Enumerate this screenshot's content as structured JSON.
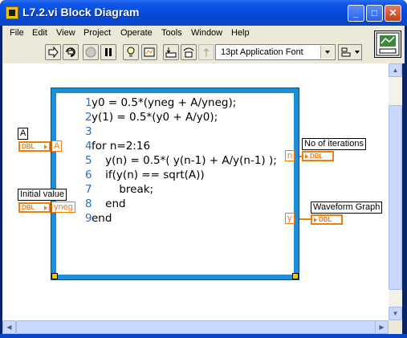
{
  "window": {
    "title": "L7.2.vi Block Diagram"
  },
  "menu": [
    "File",
    "Edit",
    "View",
    "Project",
    "Operate",
    "Tools",
    "Window",
    "Help"
  ],
  "toolbar": {
    "font": "13pt Application Font",
    "tools": [
      "run-arrow-icon",
      "run-continuous-icon",
      "abort-icon",
      "pause-icon",
      "highlight-execution-icon",
      "retain-wire-values-icon",
      "step-into-icon",
      "step-over-icon",
      "step-out-icon"
    ]
  },
  "formula": {
    "lines": [
      {
        "n": "1",
        "text": "y0 = 0.5*(yneg + A/yneg);"
      },
      {
        "n": "2",
        "text": "y(1) = 0.5*(y0 + A/y0);"
      },
      {
        "n": "3",
        "text": ""
      },
      {
        "n": "4",
        "text": "for n=2:16"
      },
      {
        "n": "5",
        "text": "    y(n) = 0.5*( y(n-1) + A/y(n-1) );"
      },
      {
        "n": "6",
        "text": "    if(y(n) == sqrt(A))"
      },
      {
        "n": "7",
        "text": "        break;"
      },
      {
        "n": "8",
        "text": "    end"
      },
      {
        "n": "9",
        "text": "end"
      }
    ]
  },
  "inputs": {
    "a": {
      "label": "A",
      "terminal": "A",
      "type": "DBL"
    },
    "initial": {
      "label": "Initial value",
      "terminal": "yneg",
      "type": "DBL"
    }
  },
  "outputs": {
    "iterations": {
      "label": "No of iterations",
      "terminal": "n",
      "type": "DBL"
    },
    "graph": {
      "label": "Waveform Graph",
      "terminal": "y",
      "type": "DBL"
    }
  },
  "colors": {
    "wire": "#f07d0f",
    "node_border": "#1e8fd6",
    "titlebar": "#0649d6"
  }
}
